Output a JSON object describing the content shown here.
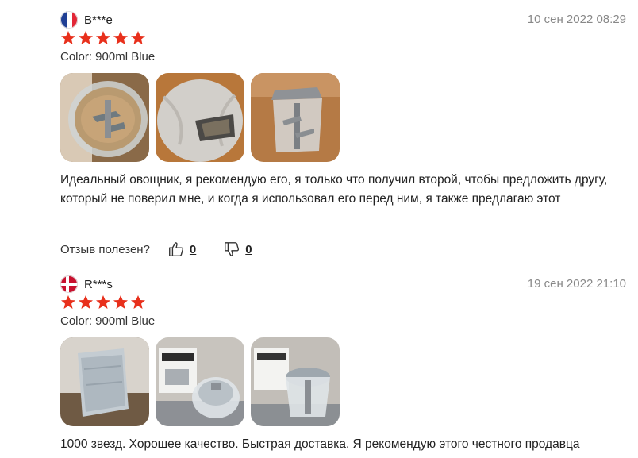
{
  "reviews": [
    {
      "author": "B***e",
      "country_flag": "france-flag",
      "date": "10 сен 2022 08:29",
      "rating": 5,
      "variant": "Color: 900ml Blue",
      "photos": [
        "chopper-blade-photo",
        "chopper-lid-photo",
        "chopper-jar-photo"
      ],
      "text": "Идеальный овощник, я рекомендую его, я только что получил второй, чтобы предложить другу, который не поверил мне, и когда я использовал его перед ним, я также предлагаю этот",
      "helpful_label": "Отзыв полезен?",
      "likes": "0",
      "dislikes": "0"
    },
    {
      "author": "R***s",
      "country_flag": "denmark-flag",
      "date": "19 сен 2022 21:10",
      "rating": 5,
      "variant": "Color: 900ml Blue",
      "photos": [
        "package-photo",
        "chopper-box-photo",
        "chopper-assembled-photo"
      ],
      "text": "1000 звезд. Хорошее качество. Быстрая доставка. Я рекомендую этого честного продавца"
    }
  ],
  "colors": {
    "star": "#e8301c",
    "date": "#888888"
  }
}
